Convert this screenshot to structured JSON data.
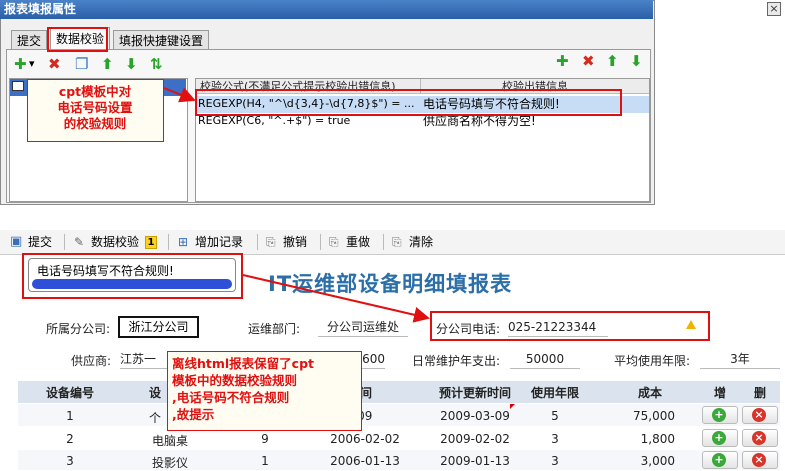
{
  "dialog": {
    "title": "报表填报属性",
    "close_glyph": "×",
    "tabs": [
      "提交",
      "数据校验",
      "填报快捷键设置"
    ],
    "left_toolbar": [
      {
        "icon": "add-icon",
        "glyph": "✚",
        "label": ""
      },
      {
        "icon": "dropdown-arrow-icon",
        "glyph": "▾",
        "label": ""
      },
      {
        "icon": "delete-icon",
        "glyph": "✖",
        "label": ""
      },
      {
        "icon": "copy-icon",
        "glyph": "❐",
        "label": ""
      },
      {
        "icon": "move-up-icon",
        "glyph": "⬆",
        "label": ""
      },
      {
        "icon": "move-down-icon",
        "glyph": "⬇",
        "label": ""
      },
      {
        "icon": "sort-icon",
        "glyph": "⇅",
        "label": ""
      }
    ],
    "right_toolbar": [
      {
        "icon": "add-icon",
        "glyph": "✚"
      },
      {
        "icon": "delete-icon",
        "glyph": "✖"
      },
      {
        "icon": "move-up-icon",
        "glyph": "⬆"
      },
      {
        "icon": "move-down-icon",
        "glyph": "⬇"
      }
    ],
    "table_headers": [
      "校验公式(不满足公式提示校验出错信息)",
      "校验出错信息"
    ],
    "rules": [
      {
        "formula": "REGEXP(H4, \"^\\d{3,4}-\\d{7,8}$\") = ...",
        "message": "电话号码填写不符合规则!"
      },
      {
        "formula": "REGEXP(C6, \"^.+$\") = true",
        "message": "供应商名称不得为空!"
      }
    ]
  },
  "callout_top": {
    "lines": [
      "cpt模板中对",
      "电话号码设置",
      "的校验规则"
    ]
  },
  "toolbar": {
    "submit": "提交",
    "validate": "数据校验",
    "validate_badge": "1",
    "add_record": "增加记录",
    "undo": "撤销",
    "redo": "重做",
    "clear": "清除"
  },
  "tooltip": {
    "text": "电话号码填写不符合规则!"
  },
  "report": {
    "title": "IT运维部设备明细填报表",
    "company_label": "所属分公司:",
    "company_value": "浙江分公司",
    "dept_label": "运维部门:",
    "dept_value": "分公司运维处",
    "phone_label": "分公司电话:",
    "phone_value": "025-21223344",
    "supplier_label": "供应商:",
    "supplier_value": "江苏一",
    "budget_partial": "600",
    "maintenance_label": "日常维护年支出:",
    "maintenance_value": "50000",
    "avg_life_label": "平均使用年限:",
    "avg_life_value": "3年",
    "columns": [
      "设备编号",
      "设",
      "时间",
      "预计更新时间",
      "使用年限",
      "成本",
      "增",
      "删"
    ],
    "rows": [
      {
        "id": "1",
        "name": "个",
        "qty": "",
        "date": "03-09",
        "update": "2009-03-09",
        "years": "5",
        "cost": "75,000"
      },
      {
        "id": "2",
        "name": "电脑桌",
        "qty": "9",
        "date": "2006-02-02",
        "update": "2009-02-02",
        "years": "3",
        "cost": "1,800"
      },
      {
        "id": "3",
        "name": "投影仪",
        "qty": "1",
        "date": "2006-01-13",
        "update": "2009-01-13",
        "years": "3",
        "cost": "3,000"
      }
    ]
  },
  "callout_bottom": {
    "lines": [
      "离线html报表保留了cpt",
      "模板中的数据校验规则",
      ",电话号码不符合规则",
      ",故提示"
    ]
  },
  "colors": {
    "accent": "#2c6fa8",
    "annotation": "#e01010",
    "header_bg": "#dbe4ee"
  }
}
